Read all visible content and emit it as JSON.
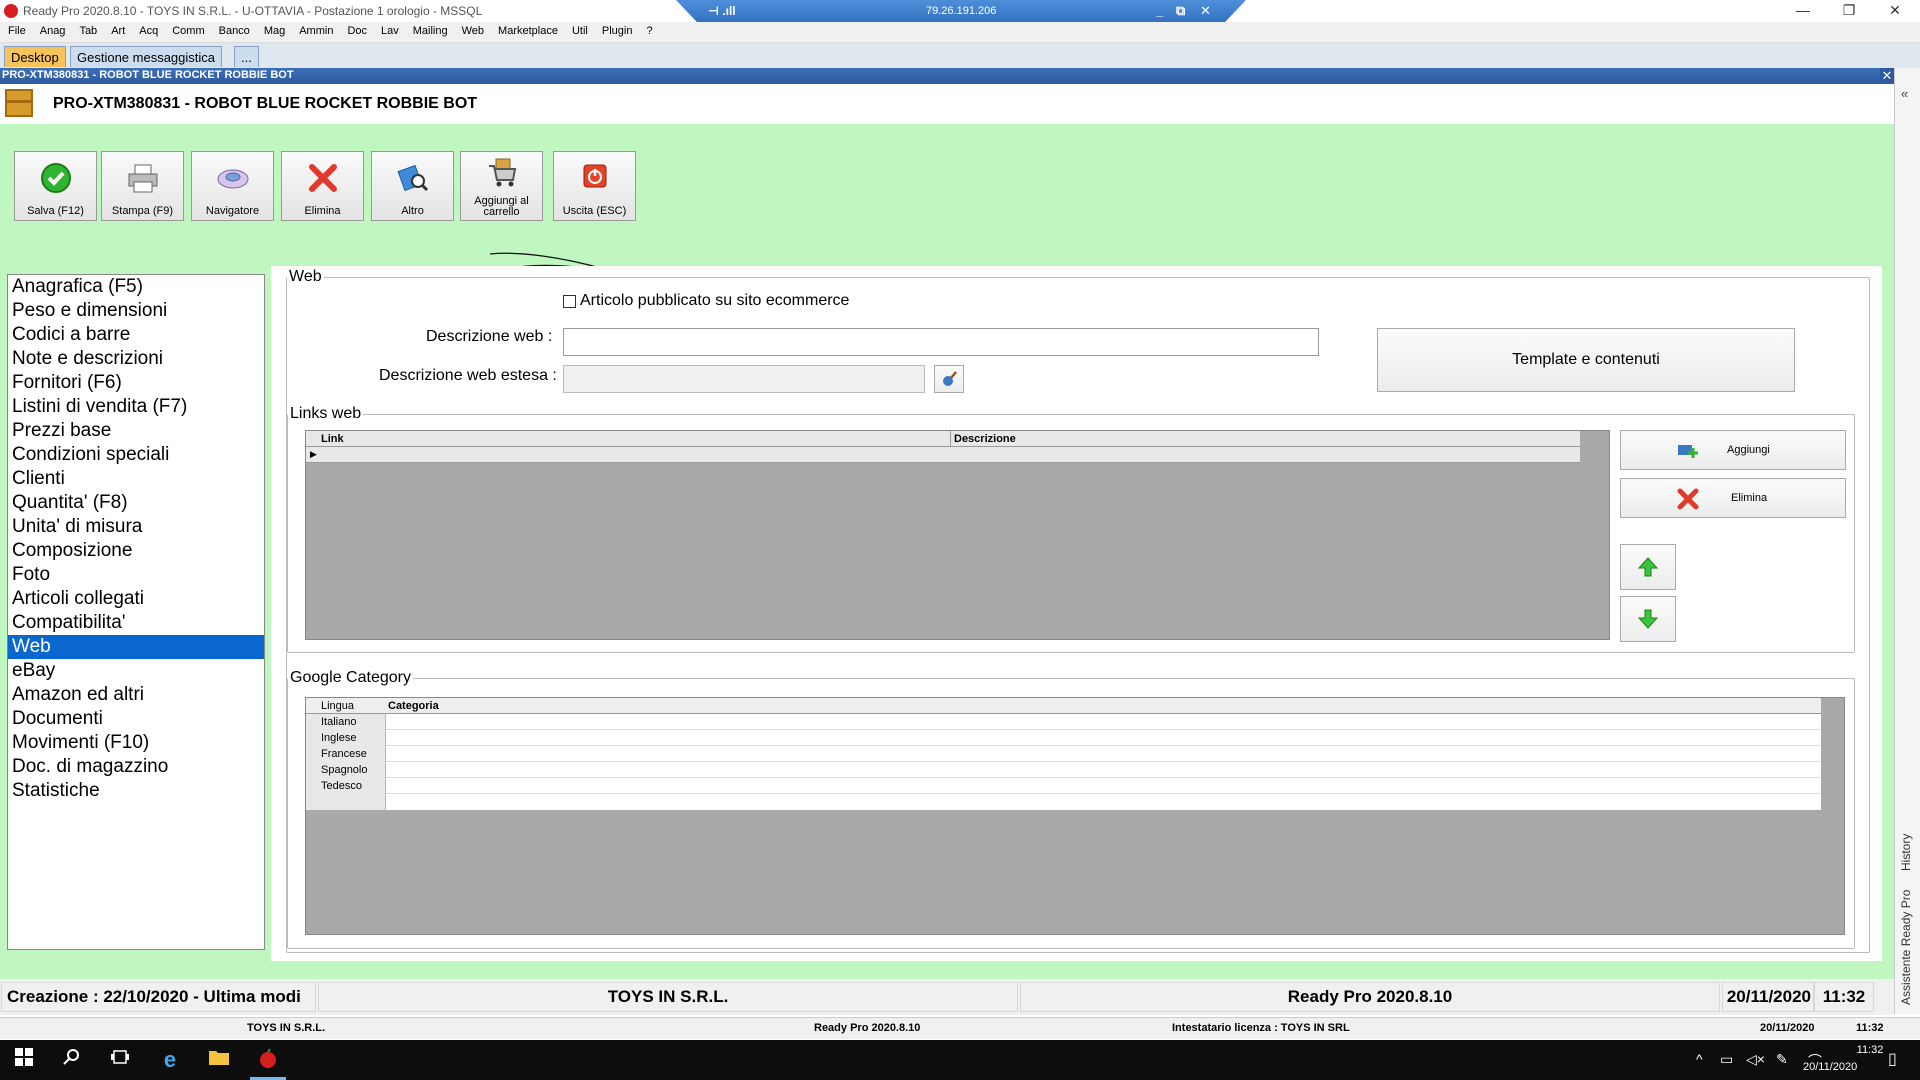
{
  "window": {
    "title": "Ready Pro 2020.8.10 - TOYS IN S.R.L. - U-OTTAVIA - Postazione 1 orologio - MSSQL",
    "remote_ip": "79.26.191.206"
  },
  "menu": [
    "File",
    "Anag",
    "Tab",
    "Art",
    "Acq",
    "Comm",
    "Banco",
    "Mag",
    "Ammin",
    "Doc",
    "Lav",
    "Mailing",
    "Web",
    "Marketplace",
    "Util",
    "Plugin",
    "?"
  ],
  "tabs": [
    {
      "label": "Desktop",
      "active": true
    },
    {
      "label": "Gestione messaggistica",
      "active": false
    },
    {
      "label": "...",
      "active": false
    }
  ],
  "child": {
    "header": "PRO-XTM380831 - ROBOT BLUE ROCKET ROBBIE BOT",
    "title": "PRO-XTM380831 - ROBOT BLUE ROCKET ROBBIE BOT"
  },
  "toolbar": [
    {
      "label": "Salva (F12)",
      "icon": "check-icon"
    },
    {
      "label": "Stampa (F9)",
      "icon": "printer-icon"
    },
    {
      "label": "Navigatore",
      "icon": "navigator-icon"
    },
    {
      "label": "Elimina",
      "icon": "delete-x-icon"
    },
    {
      "label": "Altro",
      "icon": "search-document-icon"
    },
    {
      "label": "Aggiungi al carrello",
      "icon": "cart-icon"
    },
    {
      "label": "Uscita (ESC)",
      "icon": "power-exit-icon"
    }
  ],
  "sections": [
    "Anagrafica (F5)",
    "Peso e dimensioni",
    "Codici a barre",
    "Note e descrizioni",
    "Fornitori (F6)",
    "Listini di vendita (F7)",
    "Prezzi base",
    "Condizioni speciali",
    "Clienti",
    "Quantita' (F8)",
    "Unita' di misura",
    "Composizione",
    "Foto",
    "Articoli collegati",
    "Compatibilita'",
    "Web",
    "eBay",
    "Amazon ed altri",
    "Documenti",
    "Movimenti (F10)",
    "Doc. di magazzino",
    "Statistiche"
  ],
  "selected_section": "Web",
  "web": {
    "group_title": "Web",
    "published_label": "Articolo pubblicato su sito ecommerce",
    "published_checked": false,
    "desc_web_label": "Descrizione web :",
    "desc_web_value": "",
    "desc_ext_label": "Descrizione web estesa :",
    "desc_ext_value": "",
    "template_button": "Template e contenuti"
  },
  "links": {
    "group_title": "Links web",
    "columns": [
      "Link",
      "Descrizione"
    ],
    "add_button": "Aggiungi",
    "delete_button": "Elimina"
  },
  "google": {
    "group_title": "Google Category",
    "columns": [
      "Lingua",
      "Categoria"
    ],
    "rows": [
      "Italiano",
      "Inglese",
      "Francese",
      "Spagnolo",
      "Tedesco"
    ]
  },
  "status": {
    "created": "Creazione : 22/10/2020 - Ultima modi",
    "company": "TOYS IN S.R.L.",
    "version": "Ready Pro 2020.8.10",
    "date": "20/11/2020",
    "time": "11:32"
  },
  "status2": {
    "company": "TOYS IN S.R.L.",
    "version": "Ready Pro 2020.8.10",
    "license": "Intestatario licenza : TOYS IN SRL",
    "date": "20/11/2020",
    "time": "11:32"
  },
  "right_panel": {
    "history": "History",
    "assistant": "Assistente Ready Pro"
  },
  "taskbar": {
    "time": "11:32",
    "date": "20/11/2020"
  },
  "colors": {
    "content_bg": "#c0f6c0",
    "selection": "#0a67d0",
    "active_tab": "#f6c25a"
  }
}
